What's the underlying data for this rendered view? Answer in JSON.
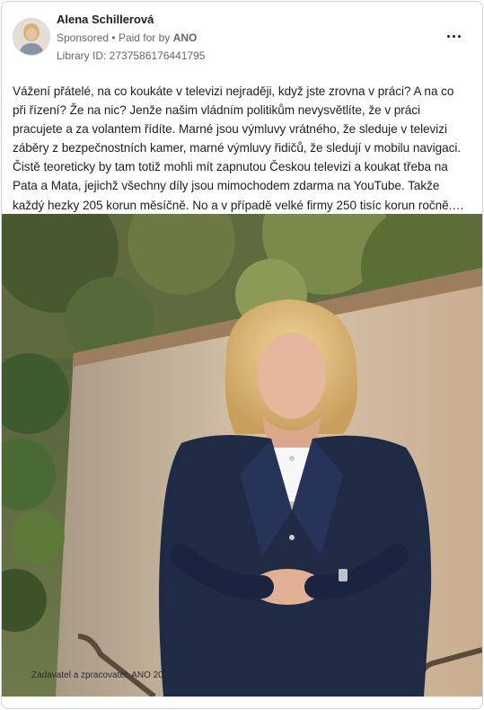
{
  "post": {
    "author_name": "Alena Schillerová",
    "sponsored_label": "Sponsored",
    "separator": "•",
    "paid_for_prefix": "Paid for by",
    "paid_for_by": "ANO",
    "library_id": "Library ID: 2737586176441795",
    "more_icon": "more-dots-icon",
    "body": "Vážení přátelé, na co koukáte v televizi nejraději, když jste zrovna v práci? A na co\npři řízení? Že na nic? Jenže našim vládním politikům nevysvětlíte, že v práci\npracujete a za volantem řídíte. Marné jsou výmluvy vrátného, že sleduje v televizi\nzáběry z bezpečnostních kamer, marné výmluvy řidičů, že sledují v mobilu navigaci.\nČistě teoreticky by tam totiž mohli mít zapnutou Českou televizi a koukat třeba na\nPata a Mata, jejichž všechny díly jsou mimochodem zdarma na YouTube. Takže\nkaždý hezky 205 korun měsíčně. No a v případě velké firmy 250 tisíc korun ročně.…",
    "image_caption": "Zadavatel a zpracovatel: ANO 2011"
  },
  "colors": {
    "text_primary": "#1c1e21",
    "text_secondary": "#65676b",
    "border": "#cfd3d8",
    "jacket_navy": "#1f2a44"
  }
}
